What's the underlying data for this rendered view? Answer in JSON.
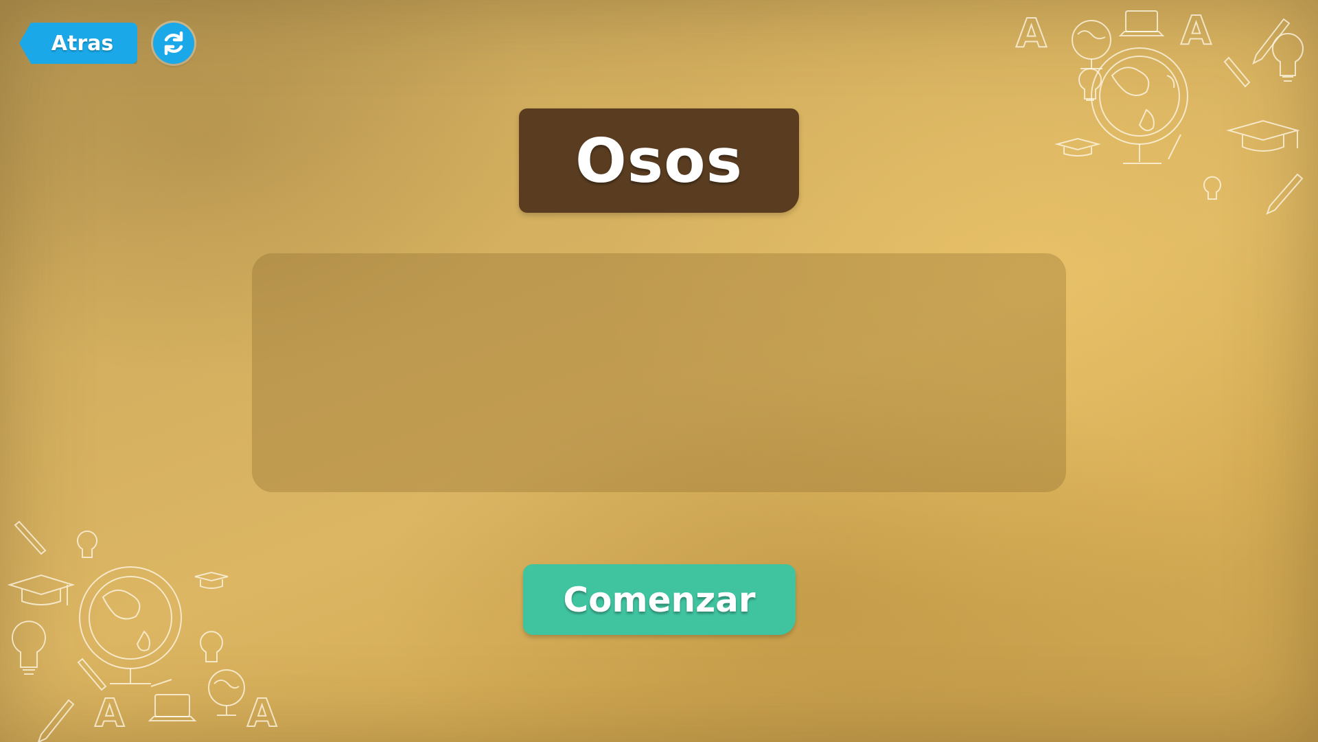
{
  "header": {
    "back_label": "Atras"
  },
  "title": "Osos",
  "content_panel": {},
  "start_label": "Comenzar",
  "icons": {
    "refresh": "refresh-icon",
    "decoration_top_right": "school-doodles",
    "decoration_bottom_left": "school-doodles"
  },
  "colors": {
    "accent_blue": "#1aa8e8",
    "title_bg": "#5a3d21",
    "start_bg": "#40c4a0"
  }
}
